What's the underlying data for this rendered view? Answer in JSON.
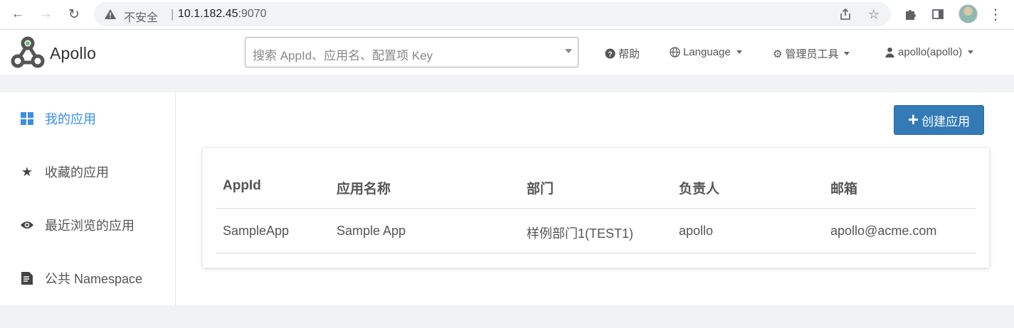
{
  "browser": {
    "insecure_label": "不安全",
    "separator": "|",
    "url_host": "10.1.182.45",
    "url_port": ":9070"
  },
  "header": {
    "logo_text": "Apollo",
    "search_placeholder": "搜索 AppId、应用名、配置项 Key",
    "help_label": "帮助",
    "language_label": "Language",
    "admin_tools_label": "管理员工具",
    "user_label": "apollo(apollo)"
  },
  "sidebar": {
    "items": [
      {
        "label": "我的应用",
        "icon": "grid-icon",
        "active": true
      },
      {
        "label": "收藏的应用",
        "icon": "star-icon",
        "active": false
      },
      {
        "label": "最近浏览的应用",
        "icon": "eye-icon",
        "active": false
      },
      {
        "label": "公共 Namespace",
        "icon": "document-icon",
        "active": false
      }
    ]
  },
  "main": {
    "create_button_label": "创建应用",
    "table": {
      "headers": [
        "AppId",
        "应用名称",
        "部门",
        "负责人",
        "邮箱"
      ],
      "rows": [
        [
          "SampleApp",
          "Sample App",
          "样例部门1(TEST1)",
          "apollo",
          "apollo@acme.com"
        ]
      ]
    }
  },
  "colors": {
    "accent": "#337ab7",
    "active_nav": "#3a8ee6",
    "page_bg": "#f0f2f5"
  }
}
